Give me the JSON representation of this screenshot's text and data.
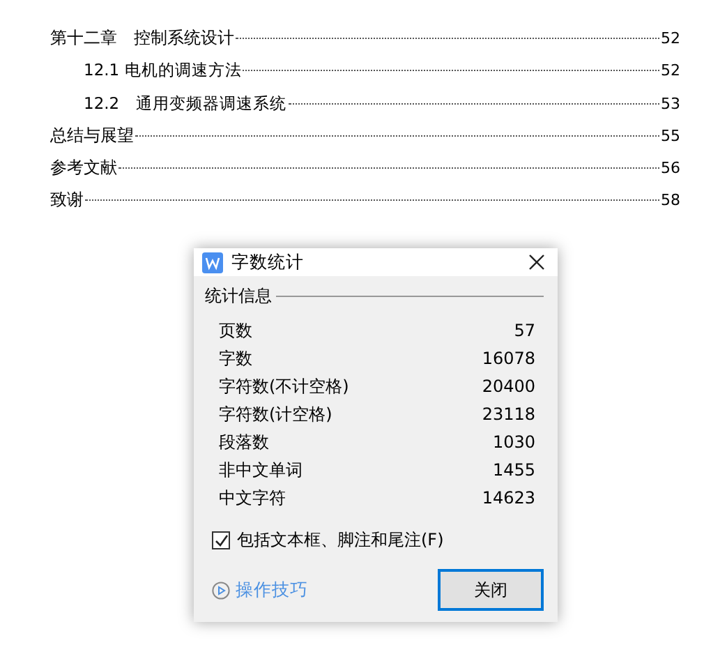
{
  "toc": [
    {
      "label": "第十二章　控制系统设计",
      "page": "52",
      "children": [
        {
          "label": "12.1 电机的调速方法",
          "page": "52"
        },
        {
          "label": "12.2　通用变频器调速系统",
          "page": "53"
        }
      ]
    },
    {
      "label": "总结与展望",
      "page": "55"
    },
    {
      "label": "参考文献",
      "page": "56"
    },
    {
      "label": "致谢",
      "page": "58"
    }
  ],
  "dialog": {
    "title": "字数统计",
    "group": "统计信息",
    "stats": [
      {
        "label": "页数",
        "value": "57"
      },
      {
        "label": "字数",
        "value": "16078"
      },
      {
        "label": "字符数(不计空格)",
        "value": "20400"
      },
      {
        "label": "字符数(计空格)",
        "value": "23118"
      },
      {
        "label": "段落数",
        "value": "1030"
      },
      {
        "label": "非中文单词",
        "value": "1455"
      },
      {
        "label": "中文字符",
        "value": "14623"
      }
    ],
    "checkbox": {
      "label": "包括文本框、脚注和尾注(F)",
      "checked": true
    },
    "tips_link": "操作技巧",
    "close_button": "关闭"
  }
}
